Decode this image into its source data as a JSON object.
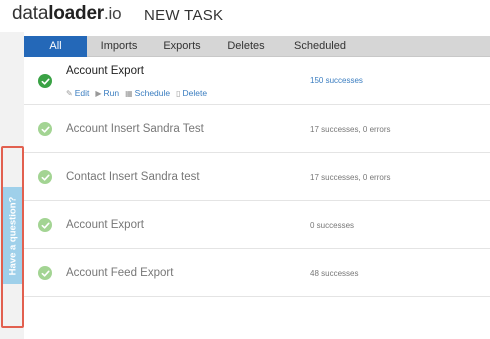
{
  "header": {
    "logo": {
      "part1": "data",
      "part2": "loader",
      "part3": ".io"
    },
    "new_task": "NEW TASK"
  },
  "feedback_tab": {
    "label": "Have a question?",
    "color": "#9fd0ea",
    "outline_color": "#e2604f"
  },
  "tabs": [
    {
      "label": "All",
      "active": true
    },
    {
      "label": "Imports",
      "active": false
    },
    {
      "label": "Exports",
      "active": false
    },
    {
      "label": "Deletes",
      "active": false
    },
    {
      "label": "Scheduled",
      "active": false
    }
  ],
  "colors": {
    "accent": "#2468b8",
    "success_strong": "#3aa245",
    "success_light": "#a3d493"
  },
  "tasks": [
    {
      "name": "Account Export",
      "status": "150 successes",
      "actions": [
        {
          "label": "Edit",
          "icon": "pencil-icon"
        },
        {
          "label": "Run",
          "icon": "play-icon"
        },
        {
          "label": "Schedule",
          "icon": "calendar-icon"
        },
        {
          "label": "Delete",
          "icon": "trash-icon"
        }
      ]
    },
    {
      "name": "Account Insert Sandra Test",
      "status": "17 successes, 0 errors"
    },
    {
      "name": "Contact Insert Sandra test",
      "status": "17 successes, 0 errors"
    },
    {
      "name": "Account Export",
      "status": "0 successes"
    },
    {
      "name": "Account Feed Export",
      "status": "48 successes"
    }
  ]
}
